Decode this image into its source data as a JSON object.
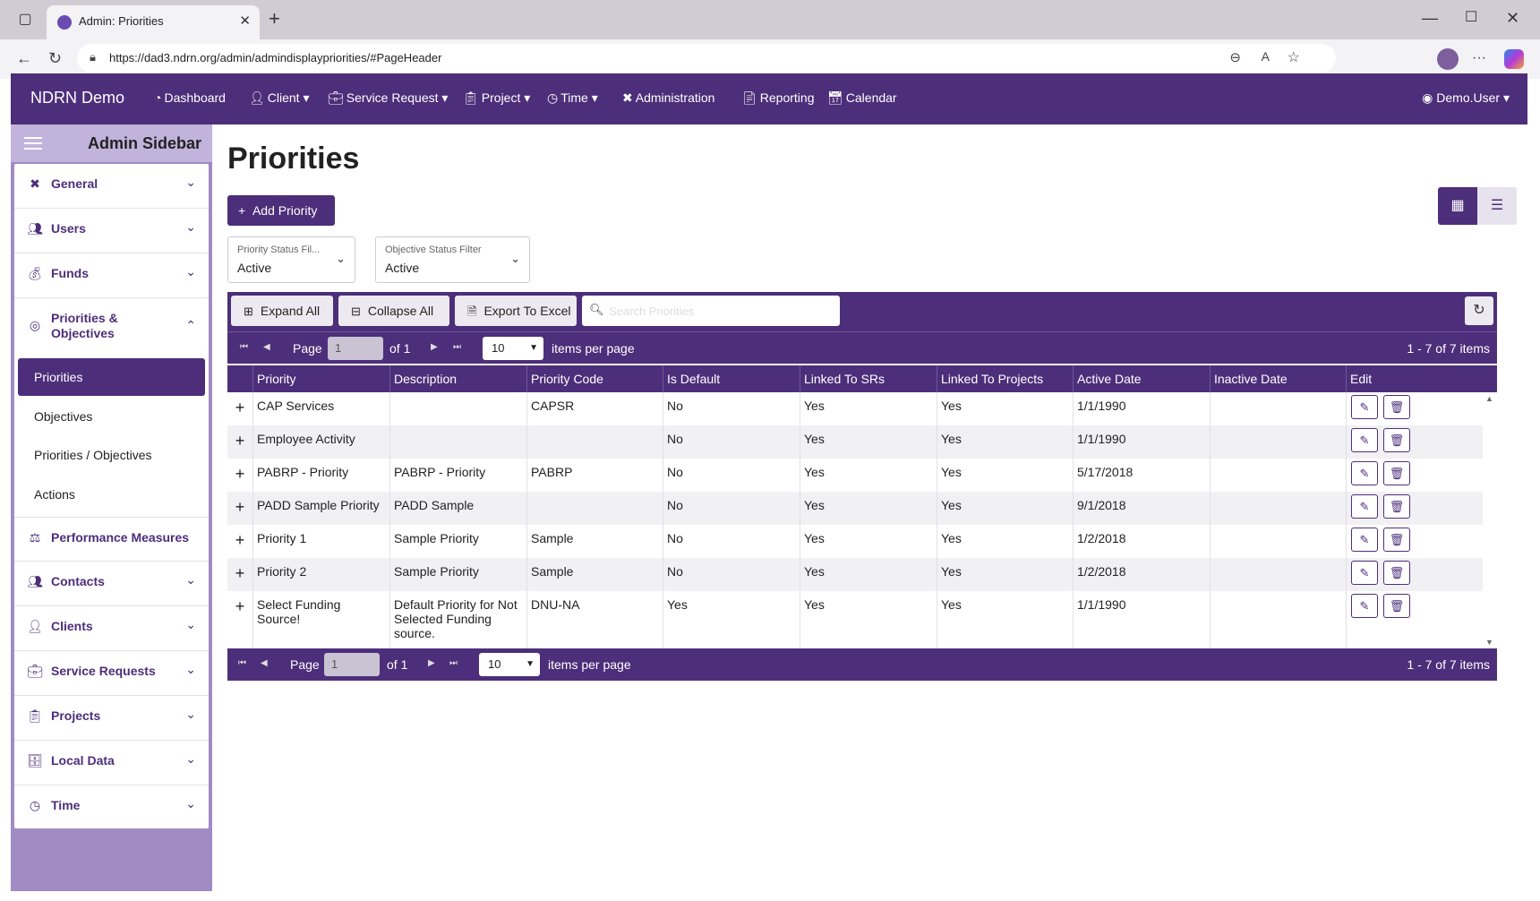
{
  "browser": {
    "tab_title": "Admin: Priorities",
    "url": "https://dad3.ndrn.org/admin/admindisplaypriorities/#PageHeader"
  },
  "navbar": {
    "brand": "NDRN Demo",
    "items": [
      {
        "label": "Dashboard",
        "icon": "dashboard-icon"
      },
      {
        "label": "Client",
        "icon": "user-icon"
      },
      {
        "label": "Service Request",
        "icon": "briefcase-icon"
      },
      {
        "label": "Project",
        "icon": "clipboard-icon"
      },
      {
        "label": "Time",
        "icon": "clock-icon"
      },
      {
        "label": "Administration",
        "icon": "tools-icon"
      },
      {
        "label": "Reporting",
        "icon": "file-icon"
      },
      {
        "label": "Calendar",
        "icon": "calendar-icon"
      }
    ],
    "user": "Demo.User"
  },
  "sidebar": {
    "title": "Admin Sidebar",
    "sections": [
      {
        "label": "General",
        "icon": "tools-icon"
      },
      {
        "label": "Users",
        "icon": "users-icon"
      },
      {
        "label": "Funds",
        "icon": "money-bag-icon"
      },
      {
        "label": "Priorities & Objectives",
        "icon": "target-icon"
      },
      {
        "label": "Performance Measures",
        "icon": "scale-icon"
      },
      {
        "label": "Contacts",
        "icon": "users-icon"
      },
      {
        "label": "Clients",
        "icon": "user-icon"
      },
      {
        "label": "Service Requests",
        "icon": "briefcase-icon"
      },
      {
        "label": "Projects",
        "icon": "clipboard-icon"
      },
      {
        "label": "Local Data",
        "icon": "database-icon"
      },
      {
        "label": "Time",
        "icon": "clock-icon"
      }
    ],
    "sub_items": [
      "Priorities",
      "Objectives",
      "Priorities / Objectives",
      "Actions"
    ],
    "active_sub": "Priorities"
  },
  "main": {
    "title": "Priorities",
    "add_button": "Add Priority",
    "filters": [
      {
        "label": "Priority Status Fil...",
        "value": "Active"
      },
      {
        "label": "Objective Status Filter",
        "value": "Active"
      }
    ]
  },
  "grid": {
    "toolbar": {
      "expand_all": "Expand All",
      "collapse_all": "Collapse All",
      "export": "Export To Excel",
      "search_placeholder": "Search Priorities"
    },
    "pager": {
      "page_label": "Page",
      "page_value": "1",
      "of_label": "of 1",
      "page_size": "10",
      "items_per_page": "items per page",
      "info": "1 - 7 of 7 items"
    },
    "columns": [
      "Priority",
      "Description",
      "Priority Code",
      "Is Default",
      "Linked To SRs",
      "Linked To Projects",
      "Active Date",
      "Inactive Date",
      "Edit"
    ],
    "rows": [
      [
        "CAP Services",
        "",
        "CAPSR",
        "No",
        "Yes",
        "Yes",
        "1/1/1990",
        ""
      ],
      [
        "Employee Activity",
        "",
        "",
        "No",
        "Yes",
        "Yes",
        "1/1/1990",
        ""
      ],
      [
        "PABRP - Priority",
        "PABRP - Priority",
        "PABRP",
        "No",
        "Yes",
        "Yes",
        "5/17/2018",
        ""
      ],
      [
        "PADD Sample Priority",
        "PADD Sample",
        "",
        "No",
        "Yes",
        "Yes",
        "9/1/2018",
        ""
      ],
      [
        "Priority 1",
        "Sample Priority",
        "Sample",
        "No",
        "Yes",
        "Yes",
        "1/2/2018",
        ""
      ],
      [
        "Priority 2",
        "Sample Priority",
        "Sample",
        "No",
        "Yes",
        "Yes",
        "1/2/2018",
        ""
      ],
      [
        "Select Funding Source!",
        "Default Priority for Not Selected Funding source.",
        "DNU-NA",
        "Yes",
        "Yes",
        "Yes",
        "1/1/1990",
        ""
      ]
    ]
  }
}
